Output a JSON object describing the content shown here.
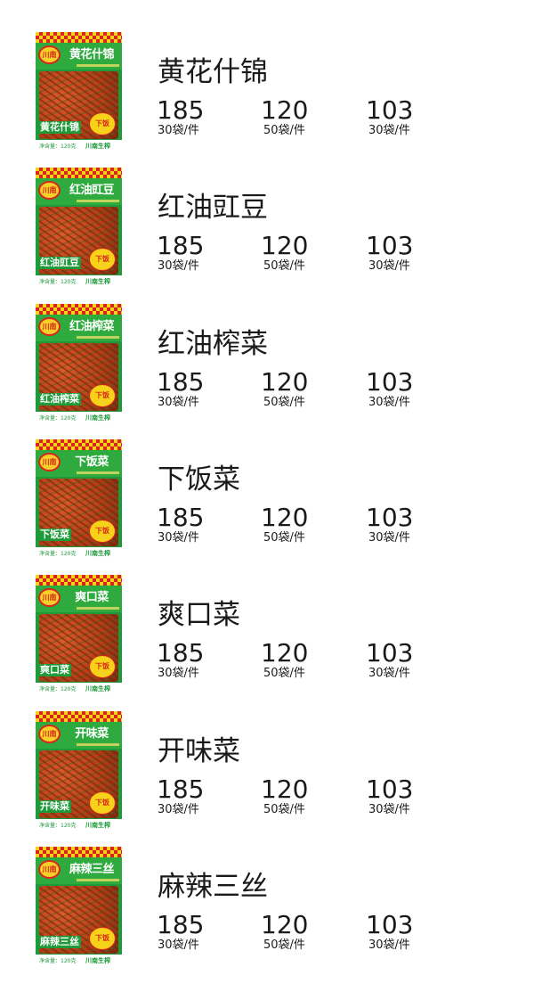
{
  "package": {
    "logo_text": "川南",
    "badge_text": "下饭",
    "brand_text": "川南生榨",
    "weight_text": "净含量：120克"
  },
  "products": [
    {
      "name": "黄花什锦",
      "prices": [
        {
          "price": "185",
          "unit": "30袋/件"
        },
        {
          "price": "120",
          "unit": "50袋/件"
        },
        {
          "price": "103",
          "unit": "30袋/件"
        }
      ]
    },
    {
      "name": "红油豇豆",
      "prices": [
        {
          "price": "185",
          "unit": "30袋/件"
        },
        {
          "price": "120",
          "unit": "50袋/件"
        },
        {
          "price": "103",
          "unit": "30袋/件"
        }
      ]
    },
    {
      "name": "红油榨菜",
      "prices": [
        {
          "price": "185",
          "unit": "30袋/件"
        },
        {
          "price": "120",
          "unit": "50袋/件"
        },
        {
          "price": "103",
          "unit": "30袋/件"
        }
      ]
    },
    {
      "name": "下饭菜",
      "prices": [
        {
          "price": "185",
          "unit": "30袋/件"
        },
        {
          "price": "120",
          "unit": "50袋/件"
        },
        {
          "price": "103",
          "unit": "30袋/件"
        }
      ]
    },
    {
      "name": "爽口菜",
      "prices": [
        {
          "price": "185",
          "unit": "30袋/件"
        },
        {
          "price": "120",
          "unit": "50袋/件"
        },
        {
          "price": "103",
          "unit": "30袋/件"
        }
      ]
    },
    {
      "name": "开味菜",
      "prices": [
        {
          "price": "185",
          "unit": "30袋/件"
        },
        {
          "price": "120",
          "unit": "50袋/件"
        },
        {
          "price": "103",
          "unit": "30袋/件"
        }
      ]
    },
    {
      "name": "麻辣三丝",
      "prices": [
        {
          "price": "185",
          "unit": "30袋/件"
        },
        {
          "price": "120",
          "unit": "50袋/件"
        },
        {
          "price": "103",
          "unit": "30袋/件"
        }
      ]
    }
  ]
}
